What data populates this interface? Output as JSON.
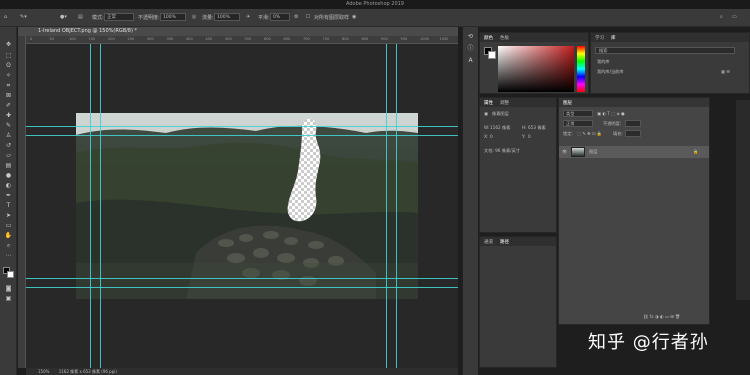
{
  "app": {
    "title": "Adobe Photoshop 2019"
  },
  "options_bar": {
    "mode_label": "模式:",
    "mode_value": "正常",
    "opacity_label": "不透明度:",
    "opacity_value": "100%",
    "flow_label": "流量:",
    "flow_value": "100%",
    "smooth_label": "平滑:",
    "smooth_value": "0%",
    "sample_label": "对所有图层取样"
  },
  "document": {
    "tab_title": "1-Ireland OBJECT.png @ 150%(RGB/8) *",
    "ruler_ticks": [
      "0",
      "50",
      "100",
      "150",
      "200",
      "250",
      "300",
      "350",
      "400",
      "450",
      "500",
      "550",
      "600",
      "650",
      "700",
      "750",
      "800",
      "850",
      "900",
      "950",
      "1000",
      "1050"
    ]
  },
  "status_bar": {
    "zoom": "150%",
    "info": "1162 像素 x 653 像素 (96 ppi)"
  },
  "color_panel": {
    "tabs": [
      "颜色",
      "色板"
    ],
    "fg": "#000000",
    "bg": "#ffffff",
    "field_color": "#a51c1c"
  },
  "learn_panel": {
    "tabs": [
      "学习",
      "库"
    ],
    "search_placeholder": "搜索",
    "library_name": "我的库",
    "library_dropdown": "我的库/当前库"
  },
  "properties_panel": {
    "tabs": [
      "属性",
      "调整"
    ],
    "layer_type": "像素图层",
    "w_label": "W:",
    "w_value": "1162 像素",
    "h_label": "H:",
    "h_value": "653 像素",
    "x_label": "X:",
    "x_value": "0",
    "y_label": "Y:",
    "y_value": "0",
    "extra": "文档: 96 像素/英寸"
  },
  "layers_panel": {
    "title": "图层",
    "kind_placeholder": "类型",
    "blend_mode": "正常",
    "opacity_label": "不透明度:",
    "opacity_value": "",
    "lock_label": "锁定:",
    "fill_label": "填充:",
    "layers": [
      {
        "name": "图层",
        "visible": true
      }
    ]
  },
  "channels_panel": {
    "tabs": [
      "通道",
      "路径"
    ]
  },
  "watermark": {
    "text": "知乎 @行者孙"
  },
  "colors": {
    "guide": "#3fd1d1",
    "panel_bg": "#3a3a3a",
    "canvas_bg": "#282828"
  }
}
